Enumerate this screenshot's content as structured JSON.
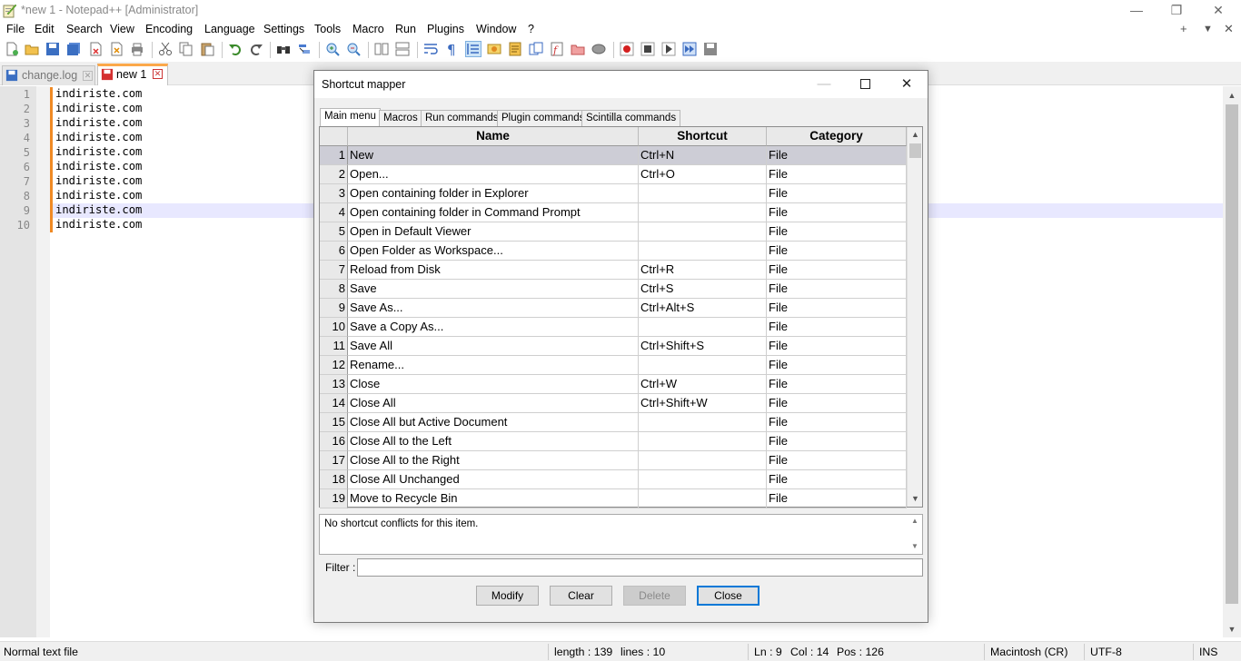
{
  "window": {
    "title": "*new 1 - Notepad++ [Administrator]",
    "controls": {
      "minimize": "—",
      "restore": "❐",
      "close": "✕"
    }
  },
  "menu": {
    "items": [
      "File",
      "Edit",
      "Search",
      "View",
      "Encoding",
      "Language",
      "Settings",
      "Tools",
      "Macro",
      "Run",
      "Plugins",
      "Window",
      "?"
    ],
    "right": {
      "plus": "+",
      "dropdown": "▼",
      "close": "✕"
    }
  },
  "tabs": [
    {
      "label": "change.log",
      "active": false
    },
    {
      "label": "new 1",
      "active": true
    }
  ],
  "editor": {
    "lines": [
      "indiriste.com",
      "indiriste.com",
      "indiriste.com",
      "indiriste.com",
      "indiriste.com",
      "indiriste.com",
      "indiriste.com",
      "indiriste.com",
      "indiriste.com",
      "indiriste.com"
    ],
    "line_numbers": [
      "1",
      "2",
      "3",
      "4",
      "5",
      "6",
      "7",
      "8",
      "9",
      "10"
    ],
    "current_line": 9
  },
  "status": {
    "file_type": "Normal text file",
    "length": "length : 139",
    "lines": "lines : 10",
    "ln": "Ln : 9",
    "col": "Col : 14",
    "pos": "Pos : 126",
    "eol": "Macintosh (CR)",
    "encoding": "UTF-8",
    "mode": "INS"
  },
  "dialog": {
    "title": "Shortcut mapper",
    "tabs": [
      "Main menu",
      "Macros",
      "Run commands",
      "Plugin commands",
      "Scintilla commands"
    ],
    "active_tab": "Main menu",
    "columns": [
      "Name",
      "Shortcut",
      "Category"
    ],
    "rows": [
      {
        "num": "1",
        "name": "New",
        "shortcut": "Ctrl+N",
        "category": "File"
      },
      {
        "num": "2",
        "name": "Open...",
        "shortcut": "Ctrl+O",
        "category": "File"
      },
      {
        "num": "3",
        "name": "Open containing folder in Explorer",
        "shortcut": "",
        "category": "File"
      },
      {
        "num": "4",
        "name": "Open containing folder in Command Prompt",
        "shortcut": "",
        "category": "File"
      },
      {
        "num": "5",
        "name": "Open in Default Viewer",
        "shortcut": "",
        "category": "File"
      },
      {
        "num": "6",
        "name": "Open Folder as Workspace...",
        "shortcut": "",
        "category": "File"
      },
      {
        "num": "7",
        "name": "Reload from Disk",
        "shortcut": "Ctrl+R",
        "category": "File"
      },
      {
        "num": "8",
        "name": "Save",
        "shortcut": "Ctrl+S",
        "category": "File"
      },
      {
        "num": "9",
        "name": "Save As...",
        "shortcut": "Ctrl+Alt+S",
        "category": "File"
      },
      {
        "num": "10",
        "name": "Save a Copy As...",
        "shortcut": "",
        "category": "File"
      },
      {
        "num": "11",
        "name": "Save All",
        "shortcut": "Ctrl+Shift+S",
        "category": "File"
      },
      {
        "num": "12",
        "name": "Rename...",
        "shortcut": "",
        "category": "File"
      },
      {
        "num": "13",
        "name": "Close",
        "shortcut": "Ctrl+W",
        "category": "File"
      },
      {
        "num": "14",
        "name": "Close All",
        "shortcut": "Ctrl+Shift+W",
        "category": "File"
      },
      {
        "num": "15",
        "name": "Close All but Active Document",
        "shortcut": "",
        "category": "File"
      },
      {
        "num": "16",
        "name": "Close All to the Left",
        "shortcut": "",
        "category": "File"
      },
      {
        "num": "17",
        "name": "Close All to the Right",
        "shortcut": "",
        "category": "File"
      },
      {
        "num": "18",
        "name": "Close All Unchanged",
        "shortcut": "",
        "category": "File"
      },
      {
        "num": "19",
        "name": "Move to Recycle Bin",
        "shortcut": "",
        "category": "File"
      }
    ],
    "selected_row": 1,
    "conflict_text": "No shortcut conflicts for this item.",
    "filter_label": "Filter :",
    "filter_value": "",
    "buttons": {
      "modify": "Modify",
      "clear": "Clear",
      "delete": "Delete",
      "close": "Close"
    }
  },
  "colors": {
    "active_tab_accent": "#fba84a",
    "change_bar": "#f08a24",
    "current_line": "#e8e8ff",
    "selected_row": "#cdcdd6",
    "default_button_border": "#0078d7"
  }
}
